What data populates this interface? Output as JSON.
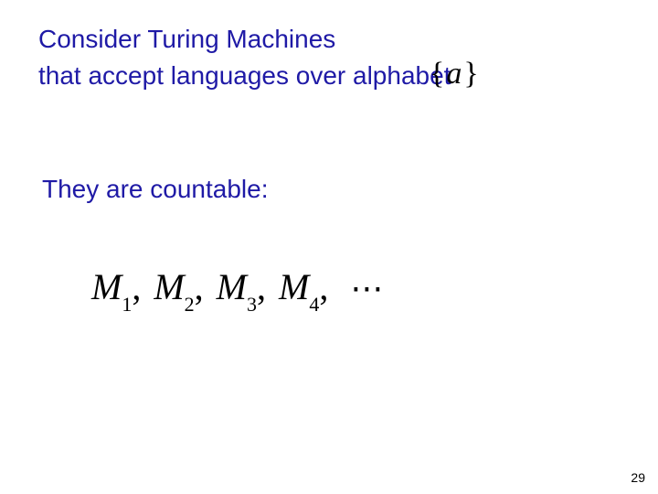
{
  "text": {
    "line1": "Consider Turing Machines",
    "line2": "that accept languages over alphabet",
    "line3": "They are countable:"
  },
  "alphabet": {
    "open": "{",
    "symbol": "a",
    "close": "}"
  },
  "machines": {
    "M": "M",
    "sub1": "1",
    "sub2": "2",
    "sub3": "3",
    "sub4": "4",
    "comma": ",",
    "ellipsis": "⋯"
  },
  "page_number": "29"
}
